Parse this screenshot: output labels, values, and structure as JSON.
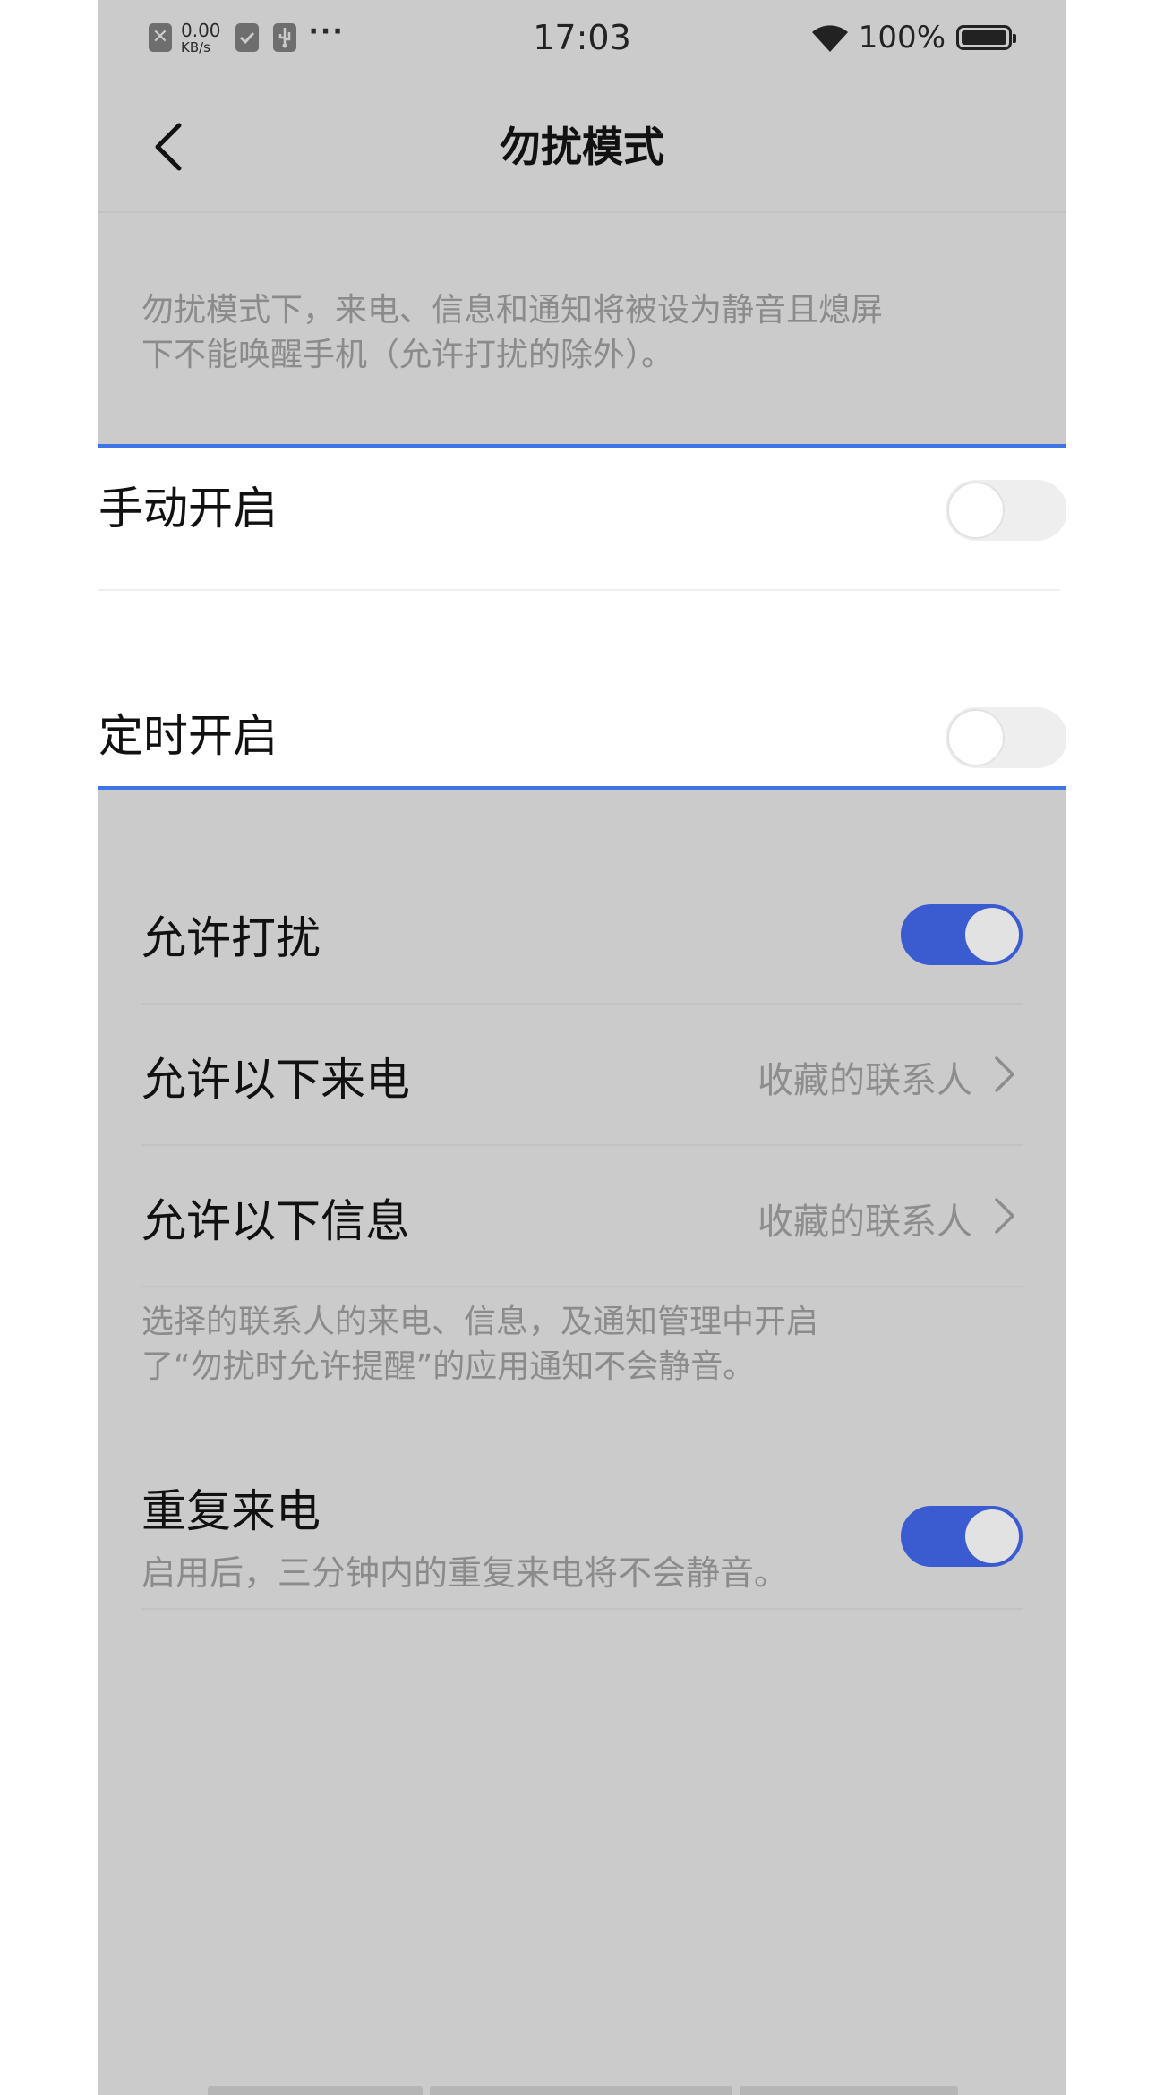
{
  "status_bar": {
    "net_speed_value": "0.00",
    "net_speed_unit": "KB/s",
    "more": "···",
    "time": "17:03",
    "battery_percent": "100%"
  },
  "header": {
    "title": "勿扰模式"
  },
  "intro": {
    "line1": "勿扰模式下，来电、信息和通知将被设为静音且熄屏",
    "line2": "下不能唤醒手机（允许打扰的除外）。"
  },
  "manual": {
    "label": "手动开启",
    "enabled": false
  },
  "scheduled": {
    "label": "定时开启",
    "enabled": false
  },
  "allow_interrupt": {
    "label": "允许打扰",
    "enabled": true
  },
  "allow_calls": {
    "label": "允许以下来电",
    "value": "收藏的联系人"
  },
  "allow_messages": {
    "label": "允许以下信息",
    "value": "收藏的联系人"
  },
  "allow_note": {
    "line1": "选择的联系人的来电、信息，及通知管理中开启",
    "line2": "了“勿扰时允许提醒”的应用通知不会静音。"
  },
  "repeat_calls": {
    "label": "重复来电",
    "description": "启用后，三分钟内的重复来电将不会静音。",
    "enabled": true
  },
  "colors": {
    "accent": "#3b5bd1",
    "highlight_border": "#3d74e6",
    "overlay_gray": "#cbcbcb"
  }
}
